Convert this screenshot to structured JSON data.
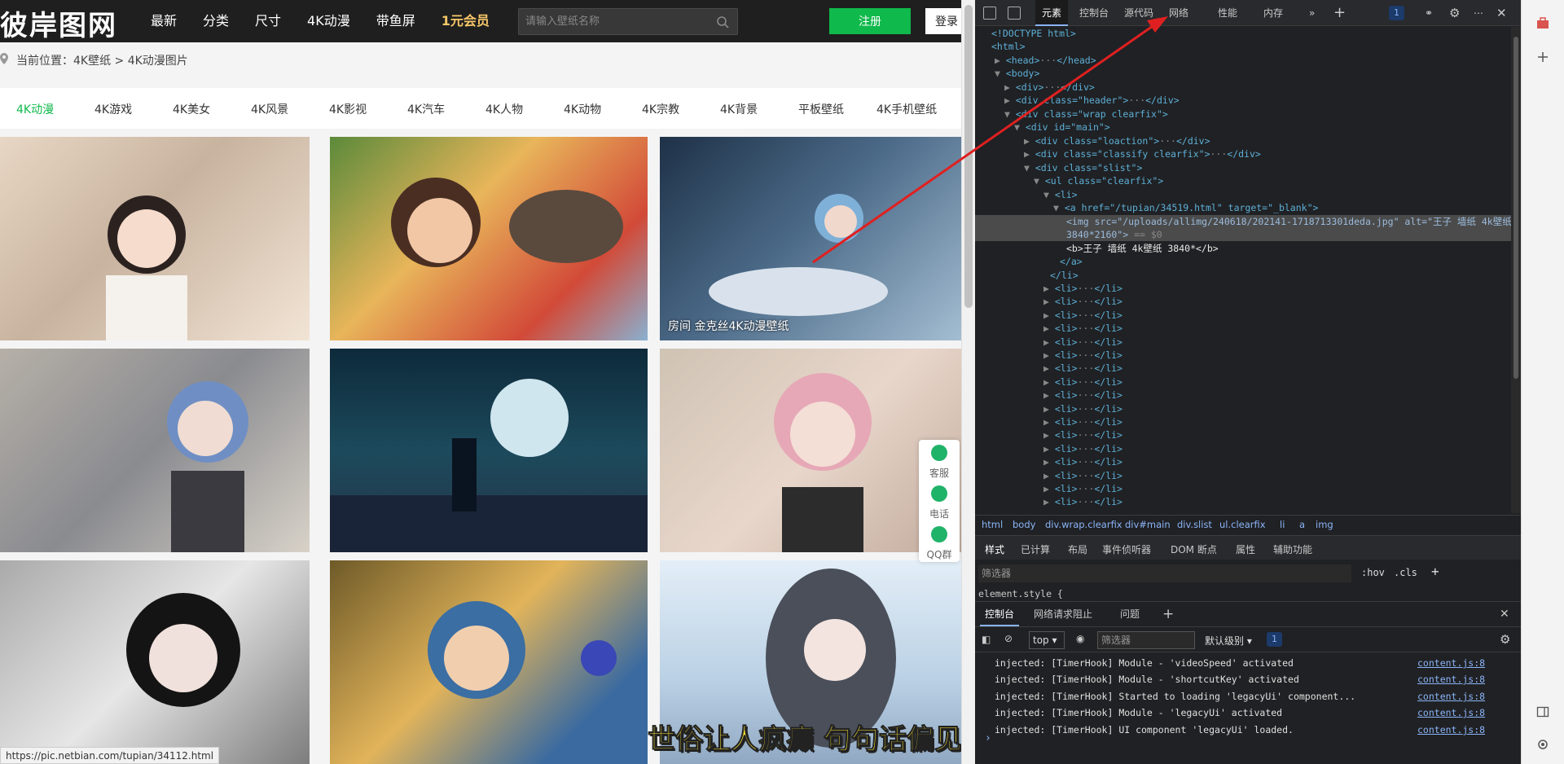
{
  "site": {
    "logo": "彼岸图网",
    "nav": [
      "最新",
      "分类",
      "尺寸",
      "4K动漫",
      "带鱼屏",
      "1元会员"
    ],
    "search_placeholder": "请输入壁纸名称",
    "register_label": "注册",
    "login_label": "登录",
    "breadcrumb": "当前位置：4K壁纸 > 4K动漫图片",
    "categories": [
      "4K动漫",
      "4K游戏",
      "4K美女",
      "4K风景",
      "4K影视",
      "4K汽车",
      "4K人物",
      "4K动物",
      "4K宗教",
      "4K背景",
      "平板壁纸",
      "4K手机壁纸"
    ],
    "active_category": "4K动漫",
    "card_caption": "房间 金克丝4K动漫壁纸",
    "float_items": [
      "客服",
      "电话",
      "QQ群"
    ],
    "video_subtitle": "世俗让人疯癫 句句话偏见",
    "status_url": "https://pic.netbian.com/tupian/34112.html",
    "colors": {
      "accent": "#10b94b",
      "vip": "#f7c76a",
      "topbar": "#1f1f1f"
    }
  },
  "devtools": {
    "tabs": [
      "元素",
      "控制台",
      "源代码",
      "网络",
      "性能",
      "内存"
    ],
    "active_tab": "元素",
    "issue_count": "1",
    "dom": {
      "doctype": "<!DOCTYPE html>",
      "html": "<html>",
      "head": "<head>",
      "head_close": "</head>",
      "body": "<body>",
      "div": "<div>",
      "div_close": "</div>",
      "div_header": "<div class=\"header\">",
      "div_wrap": "<div class=\"wrap clearfix\">",
      "div_main": "<div id=\"main\">",
      "div_loaction": "<div class=\"loaction\">",
      "div_classify": "<div class=\"classify clearfix\">",
      "div_slist": "<div class=\"slist\">",
      "ul": "<ul class=\"clearfix\">",
      "li": "<li>",
      "li_close": "</li>",
      "a_href": "<a href=\"/tupian/34519.html\" target=\"_blank\">",
      "img_line1": "<img src=\"/uploads/allimg/240618/202141-1718713301deda.jpg\" alt=\"王子 墙纸 4k壁纸",
      "img_line2": "3840*2160\">",
      "eq_sign": "== $0",
      "b_line": "<b>王子 墙纸 4k壁纸 3840*</b>",
      "a_close": "</a>",
      "ellipsis": "···"
    },
    "breadcrumb": [
      "html",
      "body",
      "div.wrap.clearfix",
      "div#main",
      "div.slist",
      "ul.clearfix",
      "li",
      "a",
      "img"
    ],
    "style_tabs": [
      "样式",
      "已计算",
      "布局",
      "事件侦听器",
      "DOM 断点",
      "属性",
      "辅助功能"
    ],
    "style_filter_placeholder": "筛选器",
    "hov": ":hov",
    "cls": ".cls",
    "element_style": "element.style {",
    "drawer_tabs": [
      "控制台",
      "网络请求阻止",
      "问题"
    ],
    "console_context": "top",
    "console_filter_placeholder": "筛选器",
    "console_level": "默认级别",
    "console_issue_count": "1",
    "logs": [
      {
        "msg": "injected: [TimerHook] Module - 'videoSpeed' activated",
        "src": "content.js:8"
      },
      {
        "msg": "injected: [TimerHook] Module - 'shortcutKey' activated",
        "src": "content.js:8"
      },
      {
        "msg": "injected: [TimerHook] Started to loading 'legacyUi' component...",
        "src": "content.js:8"
      },
      {
        "msg": "injected: [TimerHook] Module - 'legacyUi' activated",
        "src": "content.js:8"
      },
      {
        "msg": "injected: [TimerHook] UI component 'legacyUi' loaded.",
        "src": "content.js:8"
      }
    ],
    "prompt": "›"
  },
  "icons": [
    "search-icon",
    "pin-icon",
    "service-icon",
    "phone-icon",
    "qq-icon",
    "inspect-icon",
    "device-icon",
    "more-tabs-icon",
    "add-tab-icon",
    "settings-icon",
    "close-icon",
    "ban-icon",
    "eye-icon",
    "toolbox-icon",
    "plus-icon",
    "sidebar-icon",
    "gear-icon"
  ]
}
